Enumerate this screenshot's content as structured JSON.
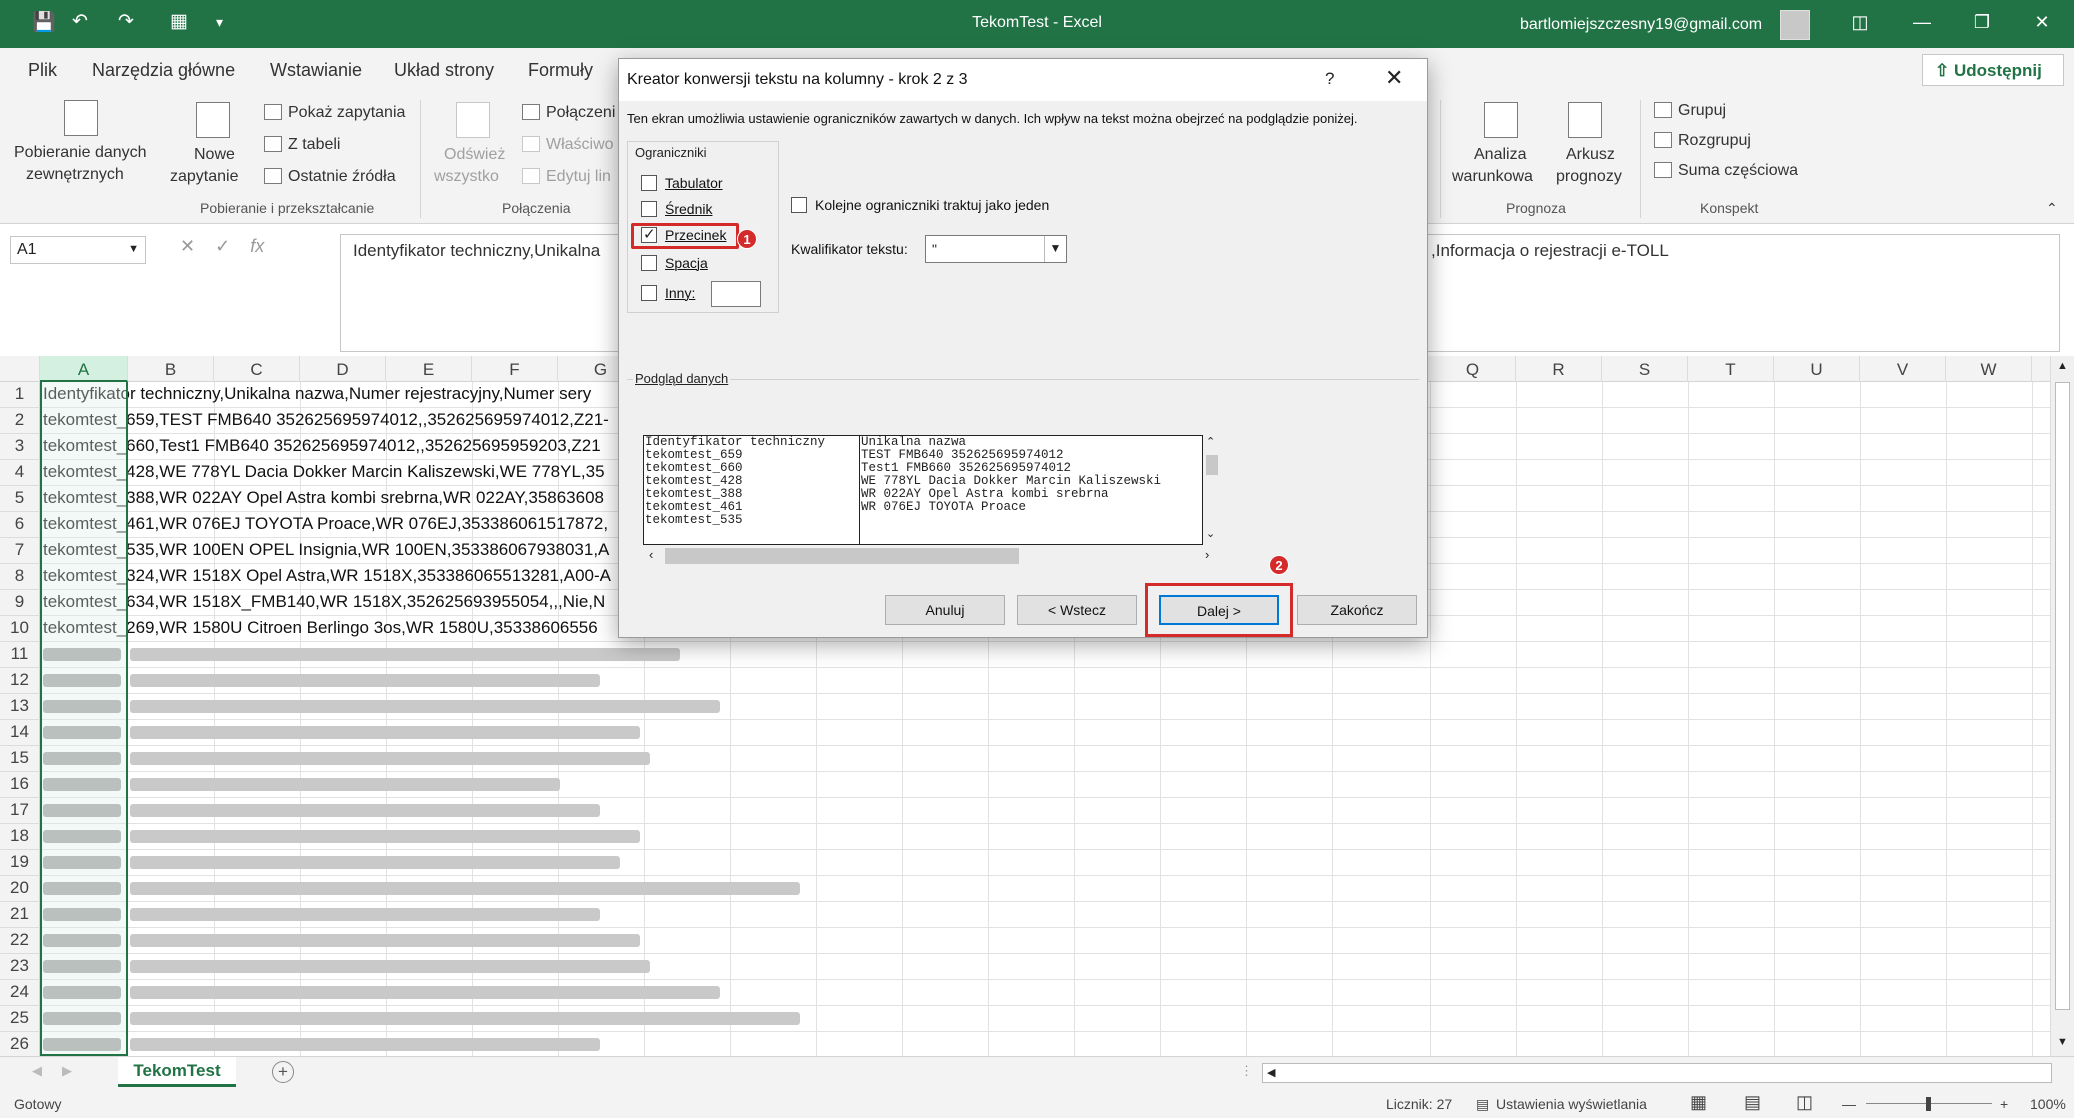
{
  "titlebar": {
    "app_title": "TekomTest  -  Excel",
    "user": "bartlomiejszczesny19@gmail.com"
  },
  "tabs": [
    "Plik",
    "Narzędzia główne",
    "Wstawianie",
    "Układ strony",
    "Formuły"
  ],
  "share_label": "Udostępnij",
  "ribbon": {
    "get_data": {
      "line1": "Pobieranie danych",
      "line2": "zewnętrznych"
    },
    "new_query": {
      "line1": "Nowe",
      "line2": "zapytanie"
    },
    "show_queries": "Pokaż zapytania",
    "from_table": "Z tabeli",
    "recent_sources": "Ostatnie źródła",
    "group_get": "Pobieranie i przekształcanie",
    "refresh": {
      "line1": "Odśwież",
      "line2": "wszystko"
    },
    "connections": "Połączeni",
    "properties": "Właściwo",
    "edit_links": "Edytuj lin",
    "group_conn": "Połączenia",
    "what_if": {
      "line1": "Analiza",
      "line2": "warunkowa"
    },
    "forecast_sheet": {
      "line1": "Arkusz",
      "line2": "prognozy"
    },
    "group_forecast": "Prognoza",
    "group_btn": "Grupuj",
    "ungroup_btn": "Rozgrupuj",
    "subtotal_btn": "Suma częściowa",
    "group_outline": "Konspekt"
  },
  "formula_bar": {
    "name_box": "A1",
    "formula_left": "Identyfikator techniczny,Unikalna",
    "formula_right": ",Informacja o rejestracji e-TOLL"
  },
  "columns": [
    "A",
    "B",
    "C",
    "D",
    "E",
    "F",
    "G",
    "Q",
    "R",
    "S",
    "T",
    "U",
    "V",
    "W"
  ],
  "rows": [
    {
      "n": "1",
      "a": "Identyfikator techniczny,Unikalna nazwa,Numer rejestracyjny,Numer sery"
    },
    {
      "n": "2",
      "a": "tekomtest_659,TEST FMB640 352625695974012,,352625695974012,Z21-"
    },
    {
      "n": "3",
      "a": "tekomtest_660,Test1 FMB640 352625695974012,,352625695959203,Z21"
    },
    {
      "n": "4",
      "a": "tekomtest_428,WE 778YL Dacia Dokker Marcin Kaliszewski,WE 778YL,35"
    },
    {
      "n": "5",
      "a": "tekomtest_388,WR 022AY Opel Astra kombi srebrna,WR 022AY,35863608"
    },
    {
      "n": "6",
      "a": "tekomtest_461,WR 076EJ TOYOTA Proace,WR 076EJ,353386061517872,"
    },
    {
      "n": "7",
      "a": "tekomtest_535,WR 100EN OPEL Insignia,WR 100EN,353386067938031,A"
    },
    {
      "n": "8",
      "a": "tekomtest_324,WR 1518X Opel Astra,WR 1518X,353386065513281,A00-A"
    },
    {
      "n": "9",
      "a": "tekomtest_634,WR 1518X_FMB140,WR 1518X,352625693955054,,,Nie,N"
    },
    {
      "n": "10",
      "a": "tekomtest_269,WR 1580U Citroen Berlingo 3os,WR 1580U,35338606556"
    },
    {
      "n": "11"
    },
    {
      "n": "12"
    },
    {
      "n": "13"
    },
    {
      "n": "14"
    },
    {
      "n": "15"
    },
    {
      "n": "16"
    },
    {
      "n": "17"
    },
    {
      "n": "18"
    },
    {
      "n": "19"
    },
    {
      "n": "20"
    },
    {
      "n": "21"
    },
    {
      "n": "22"
    },
    {
      "n": "23"
    },
    {
      "n": "24"
    },
    {
      "n": "25"
    },
    {
      "n": "26"
    }
  ],
  "sheet_tab": "TekomTest",
  "status": {
    "ready": "Gotowy",
    "count": "Licznik: 27",
    "display_settings": "Ustawienia wyświetlania",
    "zoom": "100%"
  },
  "dialog": {
    "title": "Kreator konwersji tekstu na kolumny - krok 2 z 3",
    "help": "?",
    "description": "Ten ekran umożliwia ustawienie ograniczników zawartych w danych. Ich wpływ na tekst można obejrzeć na podglądzie poniżej.",
    "delimiters_legend": "Ograniczniki",
    "delimiters": [
      {
        "label": "Tabulator",
        "checked": false
      },
      {
        "label": "Średnik",
        "checked": false
      },
      {
        "label": "Przecinek",
        "checked": true
      },
      {
        "label": "Spacja",
        "checked": false
      },
      {
        "label": "Inny:",
        "checked": false
      }
    ],
    "consecutive_label": "Kolejne ograniczniki traktuj jako jeden",
    "qualifier_label": "Kwalifikator tekstu:",
    "qualifier_value": "\"",
    "preview_legend": "Podgląd danych",
    "preview_columns": [
      [
        "Identyfikator techniczny",
        "tekomtest_659",
        "tekomtest_660",
        "tekomtest_428",
        "tekomtest_388",
        "tekomtest_461",
        "tekomtest_535"
      ],
      [
        "Unikalna nazwa",
        "TEST FMB640 352625695974012",
        "Test1 FMB660 352625695974012",
        "WE 778YL Dacia Dokker Marcin Kaliszewski",
        "WR 022AY Opel Astra kombi srebrna",
        "WR 076EJ TOYOTA Proace",
        ""
      ],
      [
        "Numer rejestracyjny",
        "",
        "",
        "WE 778YL",
        "WR 022AY",
        "WR 076EJ",
        ""
      ]
    ],
    "buttons": {
      "cancel": "Anuluj",
      "back": "< Wstecz",
      "next": "Dalej >",
      "finish": "Zakończ"
    },
    "annotations": [
      "1",
      "2"
    ]
  },
  "colors": {
    "excel_green": "#217346",
    "highlight_red": "#d42a2a"
  }
}
